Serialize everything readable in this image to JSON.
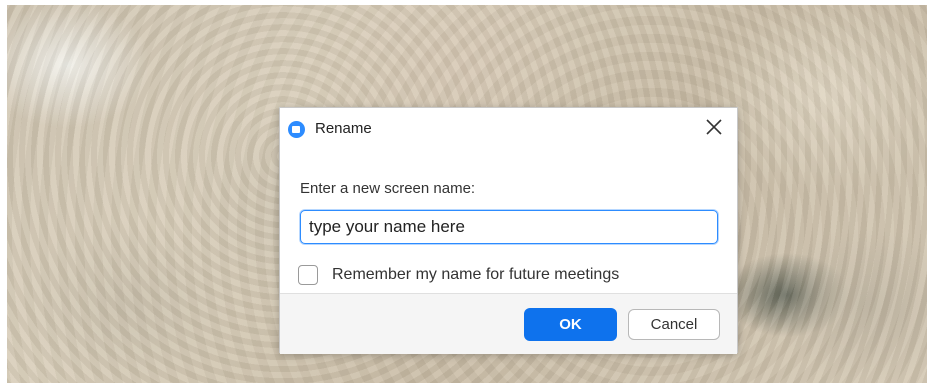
{
  "background": {
    "description_icon": "video-feed-icon"
  },
  "dialog": {
    "title": "Rename",
    "app_icon": "zoom-camera-icon",
    "close_icon": "close-icon",
    "prompt": "Enter a new screen name:",
    "name_input": {
      "value": "type your name here",
      "placeholder": ""
    },
    "remember": {
      "label": "Remember my name for future meetings",
      "checked": false
    },
    "buttons": {
      "ok": "OK",
      "cancel": "Cancel"
    },
    "accent_color": "#0e72ed"
  }
}
